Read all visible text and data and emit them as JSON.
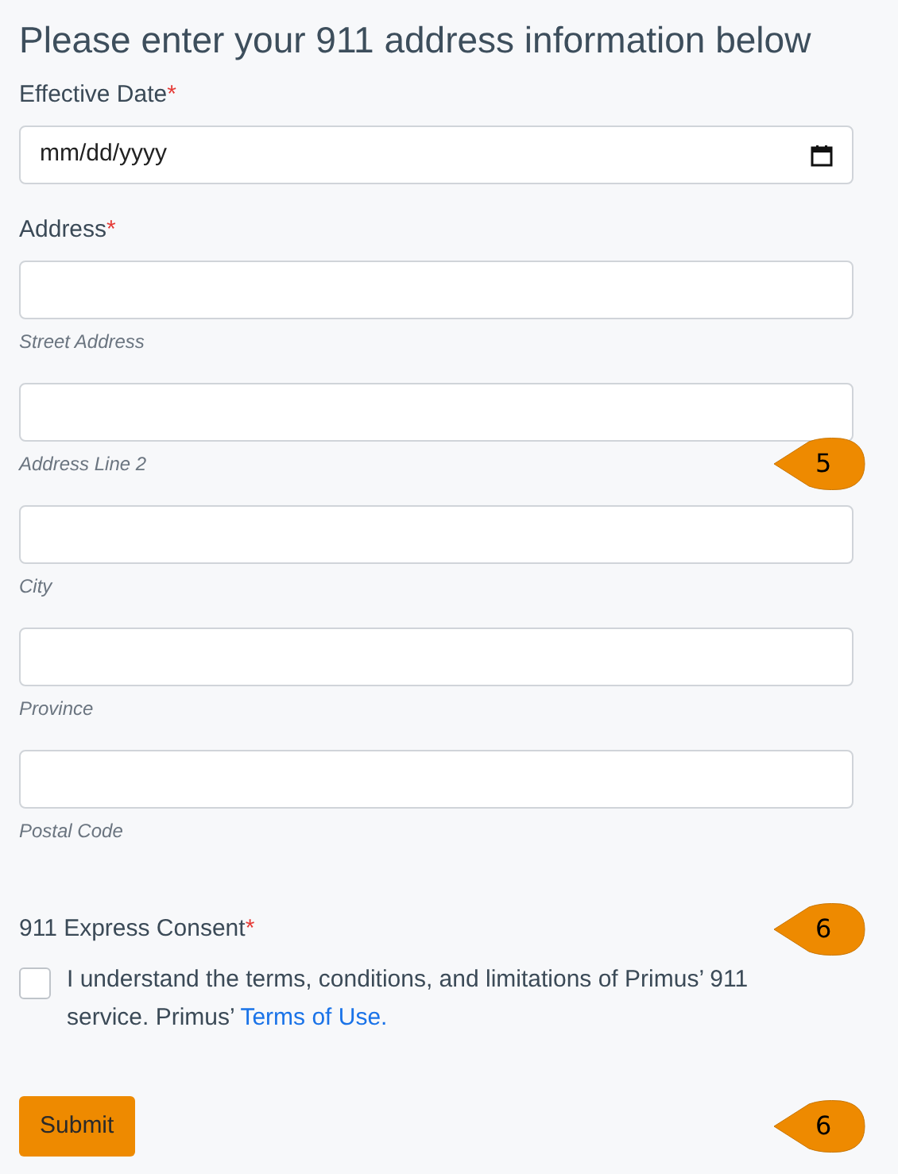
{
  "heading": "Please enter your 911 address information below",
  "effective_date": {
    "label": "Effective Date",
    "required_mark": "*",
    "placeholder": "mm/dd/yyyy"
  },
  "address": {
    "label": "Address",
    "required_mark": "*",
    "fields": [
      {
        "hint": "Street Address"
      },
      {
        "hint": "Address Line 2",
        "callout": "5"
      },
      {
        "hint": "City"
      },
      {
        "hint": "Province"
      },
      {
        "hint": "Postal Code"
      }
    ]
  },
  "consent": {
    "label": "911 Express Consent",
    "required_mark": "*",
    "callout": "6",
    "checked": false,
    "text": "I understand the terms, conditions, and limitations of Primus’ 911 service. Primus’",
    "link": "Terms of Use."
  },
  "submit": {
    "label": "Submit",
    "callout": "6"
  }
}
